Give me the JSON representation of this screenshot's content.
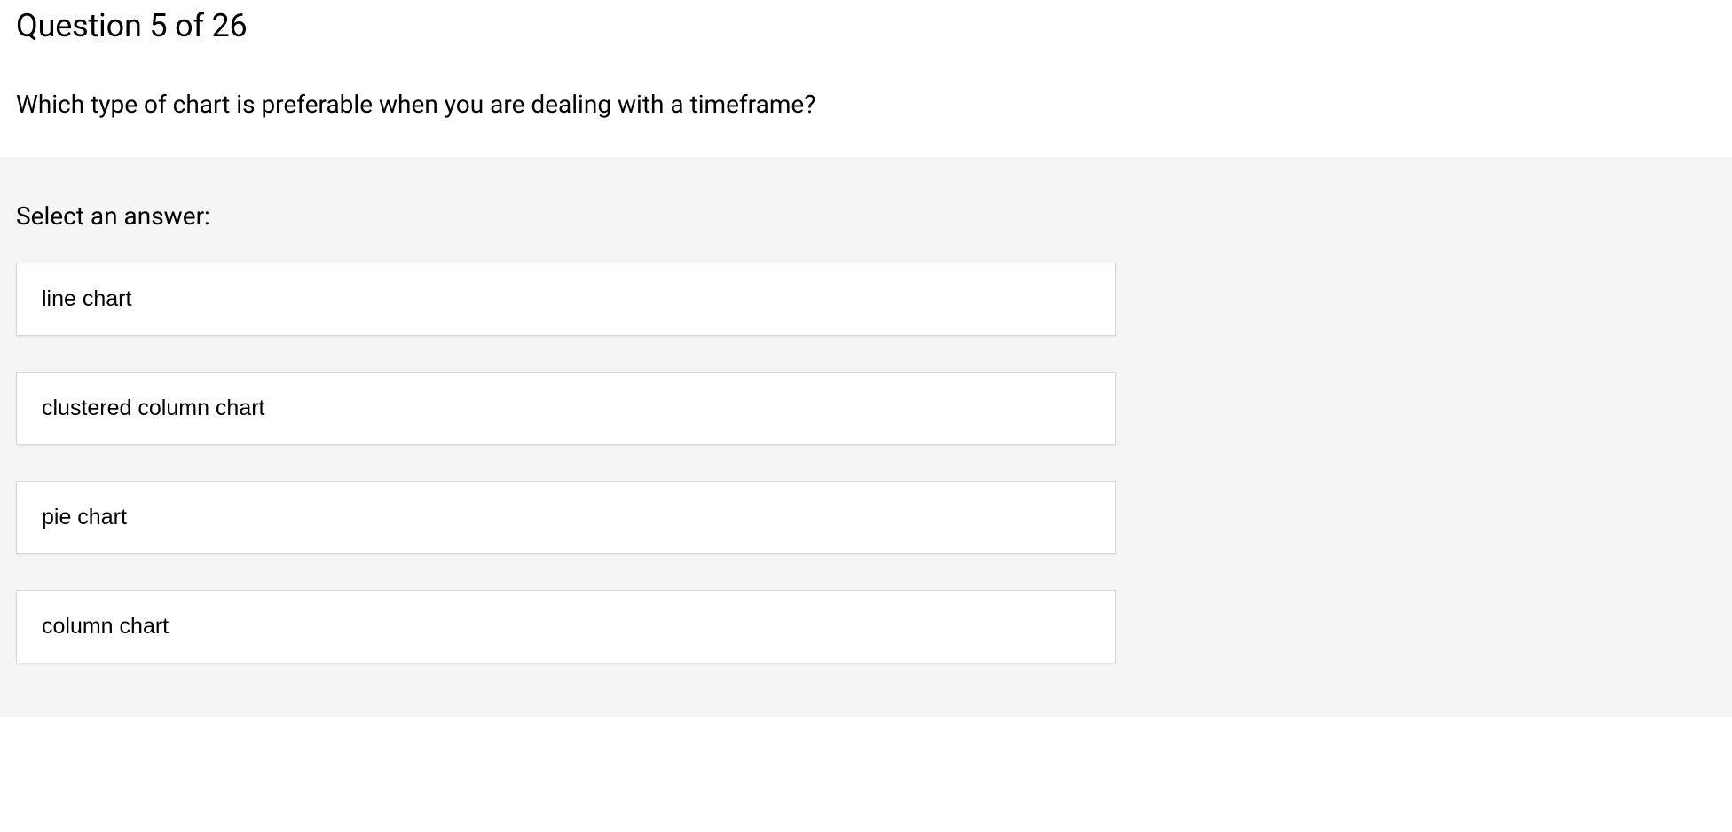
{
  "question": {
    "number_label": "Question 5 of 26",
    "text": "Which type of chart is preferable when you are dealing with a timeframe?"
  },
  "answers": {
    "select_label": "Select an answer:",
    "options": [
      "line chart",
      "clustered column chart",
      "pie chart",
      "column chart"
    ]
  }
}
